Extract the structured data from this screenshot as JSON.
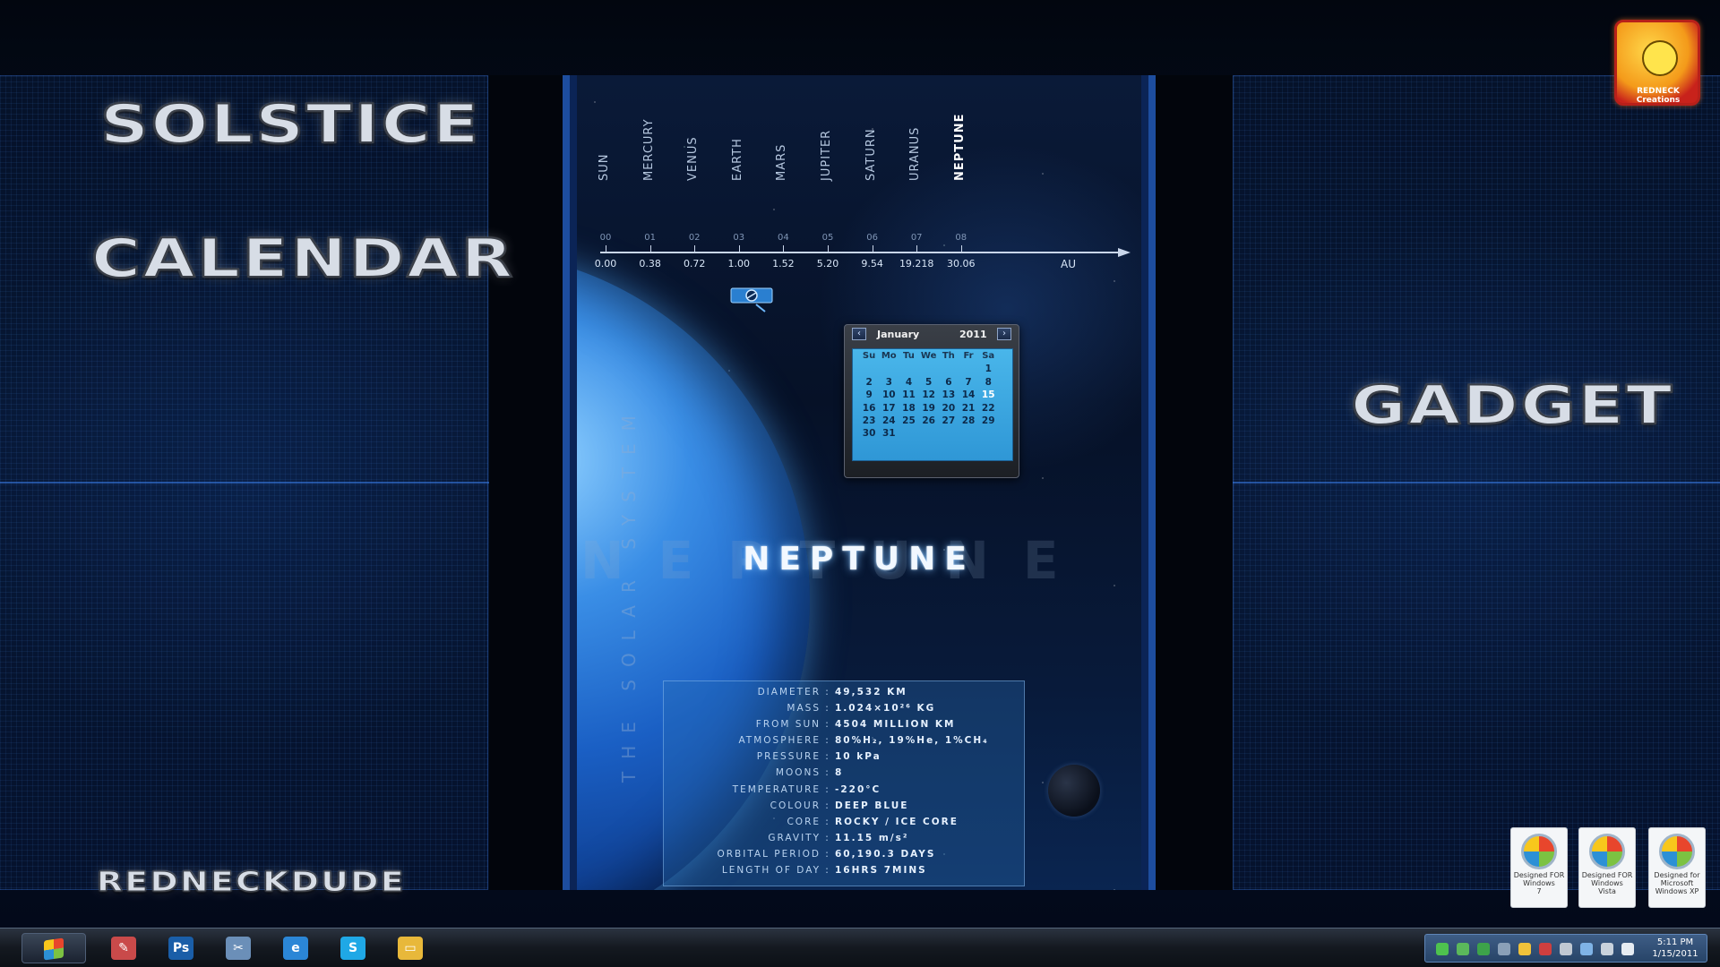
{
  "desktop": {
    "titles": {
      "solstice": "SOLSTICE",
      "calendar": "CALENDAR",
      "gadget": "GADGET",
      "author": "REDNECKDUDE"
    }
  },
  "wallpaper": {
    "planets": [
      {
        "name": "SUN",
        "index": "00",
        "distance": "0.00"
      },
      {
        "name": "MERCURY",
        "index": "01",
        "distance": "0.38"
      },
      {
        "name": "VENUS",
        "index": "02",
        "distance": "0.72"
      },
      {
        "name": "EARTH",
        "index": "03",
        "distance": "1.00"
      },
      {
        "name": "MARS",
        "index": "04",
        "distance": "1.52"
      },
      {
        "name": "JUPITER",
        "index": "05",
        "distance": "5.20"
      },
      {
        "name": "SATURN",
        "index": "06",
        "distance": "9.54"
      },
      {
        "name": "URANUS",
        "index": "07",
        "distance": "19.218"
      },
      {
        "name": "NEPTUNE",
        "index": "08",
        "distance": "30.06"
      }
    ],
    "active_planet": "NEPTUNE",
    "distance_unit": "AU",
    "series_label": "THE SOLAR SYSTEM",
    "planet_name": "NEPTUNE",
    "background_name": "NEPTUNE",
    "info": [
      {
        "key": "DIAMETER",
        "value": "49,532 KM"
      },
      {
        "key": "MASS",
        "value": "1.024×10²⁶ KG"
      },
      {
        "key": "FROM SUN",
        "value": "4504 MILLION KM"
      },
      {
        "key": "ATMOSPHERE",
        "value": "80%H₂, 19%He, 1%CH₄"
      },
      {
        "key": "PRESSURE",
        "value": "10 kPa"
      },
      {
        "key": "MOONS",
        "value": "8"
      },
      {
        "key": "TEMPERATURE",
        "value": "-220°C"
      },
      {
        "key": "COLOUR",
        "value": "DEEP BLUE"
      },
      {
        "key": "CORE",
        "value": "ROCKY / ICE CORE"
      },
      {
        "key": "GRAVITY",
        "value": "11.15 m/s²"
      },
      {
        "key": "ORBITAL PERIOD",
        "value": "60,190.3 DAYS"
      },
      {
        "key": "LENGTH OF DAY",
        "value": "16HRS 7MINS"
      }
    ]
  },
  "calendar": {
    "month": "January",
    "year": "2011",
    "weekdays": [
      "Su",
      "Mo",
      "Tu",
      "We",
      "Th",
      "Fr",
      "Sa"
    ],
    "weeks": [
      [
        "",
        "",
        "",
        "",
        "",
        "",
        "1"
      ],
      [
        "2",
        "3",
        "4",
        "5",
        "6",
        "7",
        "8"
      ],
      [
        "9",
        "10",
        "11",
        "12",
        "13",
        "14",
        "15"
      ],
      [
        "16",
        "17",
        "18",
        "19",
        "20",
        "21",
        "22"
      ],
      [
        "23",
        "24",
        "25",
        "26",
        "27",
        "28",
        "29"
      ],
      [
        "30",
        "31",
        "",
        "",
        "",
        "",
        ""
      ]
    ],
    "today": "15",
    "prev_icon": "chevron-left-icon",
    "next_icon": "chevron-right-icon"
  },
  "corner_icon": {
    "text": "REDNECK Creations"
  },
  "badges": [
    {
      "line1": "Designed FOR",
      "line2": "Windows",
      "line3": "7"
    },
    {
      "line1": "Designed FOR",
      "line2": "Windows",
      "line3": "Vista"
    },
    {
      "line1": "Designed for",
      "line2": "Microsoft",
      "line3": "Windows XP"
    }
  ],
  "taskbar": {
    "apps": [
      {
        "name": "paint-app-icon",
        "glyph": "✎",
        "color": "#c94a4a"
      },
      {
        "name": "photoshop-icon",
        "glyph": "Ps",
        "color": "#1a5ea8"
      },
      {
        "name": "tools-icon",
        "glyph": "✂",
        "color": "#6b8fb8"
      },
      {
        "name": "internet-explorer-icon",
        "glyph": "e",
        "color": "#2b86d6"
      },
      {
        "name": "skype-icon",
        "glyph": "S",
        "color": "#1fa8e6"
      },
      {
        "name": "folder-icon",
        "glyph": "▭",
        "color": "#e8b83a"
      }
    ],
    "tray_colors": [
      "#4ec24e",
      "#5bb85b",
      "#3da34a",
      "#8aa0b8",
      "#f0c23a",
      "#cf3f3f",
      "#c0c8d2",
      "#7fb3e6",
      "#c9d2dc",
      "#e6ecf2"
    ],
    "clock_time": "5:11 PM",
    "clock_date": "1/15/2011"
  }
}
